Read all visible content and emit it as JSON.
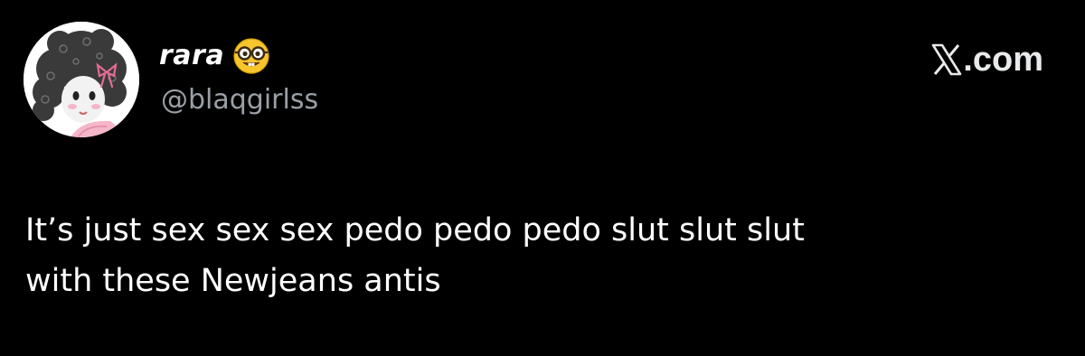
{
  "post": {
    "author": {
      "display_name": "rara",
      "name_emoji_icon": "nerd-face-emoji",
      "handle": "@blaqgirlss",
      "avatar_icon": "cartoon-girl-with-bow-avatar"
    },
    "brand": {
      "logo_icon": "x-logo-icon",
      "suffix": ".com"
    },
    "text": "It’s just sex sex sex pedo pedo pedo slut slut slut\nwith these Newjeans antis"
  },
  "colors": {
    "background": "#000000",
    "text_primary": "#ffffff",
    "text_secondary": "#9aa0a6",
    "avatar_accent": "#f4b6c8"
  }
}
